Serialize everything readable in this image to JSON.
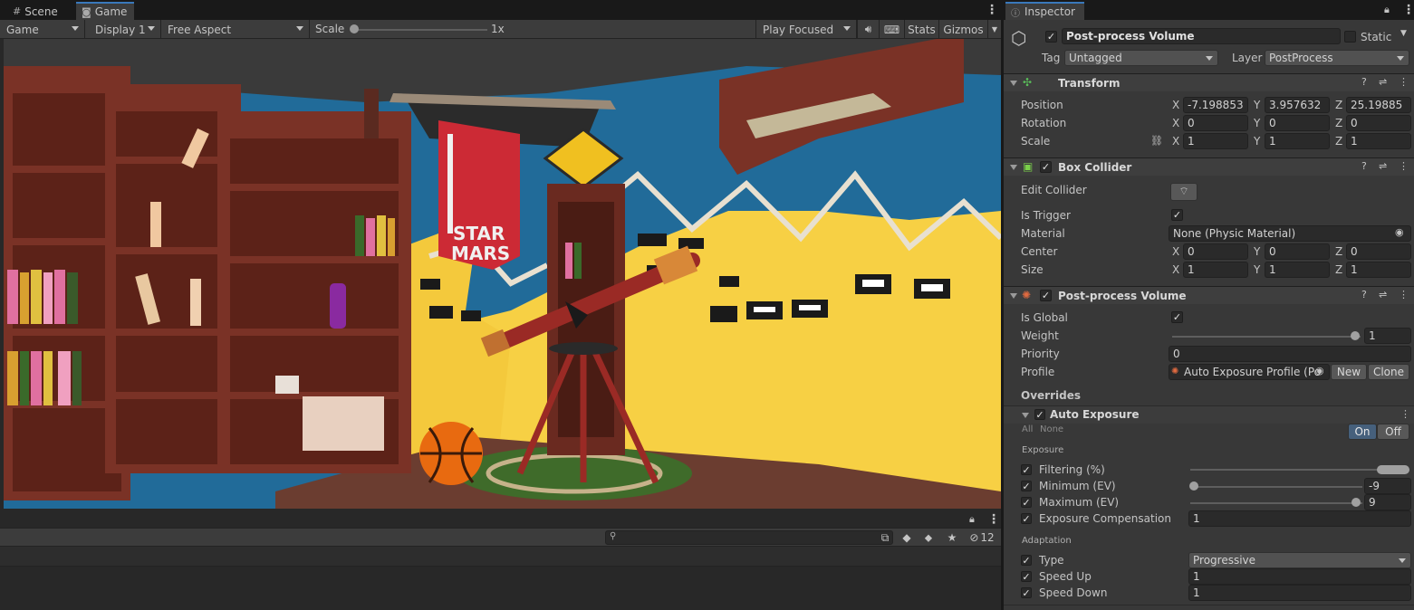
{
  "tabs": {
    "scene": "Scene",
    "game": "Game"
  },
  "game_toolbar": {
    "mode": "Game",
    "display": "Display 1",
    "aspect": "Free Aspect",
    "scale_label": "Scale",
    "scale_value": "1x",
    "play_mode": "Play Focused",
    "stats": "Stats",
    "gizmos": "Gizmos"
  },
  "viewport": {
    "poster_text_1": "STAR",
    "poster_text_2": "MARS"
  },
  "console": {
    "hidden_count": "12"
  },
  "inspector": {
    "tab_label": "Inspector",
    "object_name": "Post-process Volume",
    "static_label": "Static",
    "tag_label": "Tag",
    "tag_value": "Untagged",
    "layer_label": "Layer",
    "layer_value": "PostProcess",
    "transform": {
      "title": "Transform",
      "position_label": "Position",
      "position": {
        "x": "-7.198853",
        "y": "3.957632",
        "z": "25.19885"
      },
      "rotation_label": "Rotation",
      "rotation": {
        "x": "0",
        "y": "0",
        "z": "0"
      },
      "scale_label": "Scale",
      "scale": {
        "x": "1",
        "y": "1",
        "z": "1"
      }
    },
    "box_collider": {
      "title": "Box Collider",
      "edit_label": "Edit Collider",
      "trigger_label": "Is Trigger",
      "material_label": "Material",
      "material_value": "None (Physic Material)",
      "center_label": "Center",
      "center": {
        "x": "0",
        "y": "0",
        "z": "0"
      },
      "size_label": "Size",
      "size": {
        "x": "1",
        "y": "1",
        "z": "1"
      }
    },
    "ppv": {
      "title": "Post-process Volume",
      "global_label": "Is Global",
      "weight_label": "Weight",
      "weight_value": "1",
      "weight_fraction": 1.0,
      "priority_label": "Priority",
      "priority_value": "0",
      "profile_label": "Profile",
      "profile_value": "Auto Exposure Profile (Po",
      "new_label": "New",
      "clone_label": "Clone",
      "overrides_label": "Overrides",
      "effect_title": "Auto Exposure",
      "all_label": "All",
      "none_label": "None",
      "on_label": "On",
      "off_label": "Off",
      "exposure_section": "Exposure",
      "filtering_label": "Filtering (%)",
      "minimum_label": "Minimum (EV)",
      "minimum_value": "-9",
      "maximum_label": "Maximum (EV)",
      "maximum_value": "9",
      "compensation_label": "Exposure Compensation",
      "compensation_value": "1",
      "adaptation_section": "Adaptation",
      "type_label": "Type",
      "type_value": "Progressive",
      "speed_up_label": "Speed Up",
      "speed_up_value": "1",
      "speed_down_label": "Speed Down",
      "speed_down_value": "1"
    }
  }
}
